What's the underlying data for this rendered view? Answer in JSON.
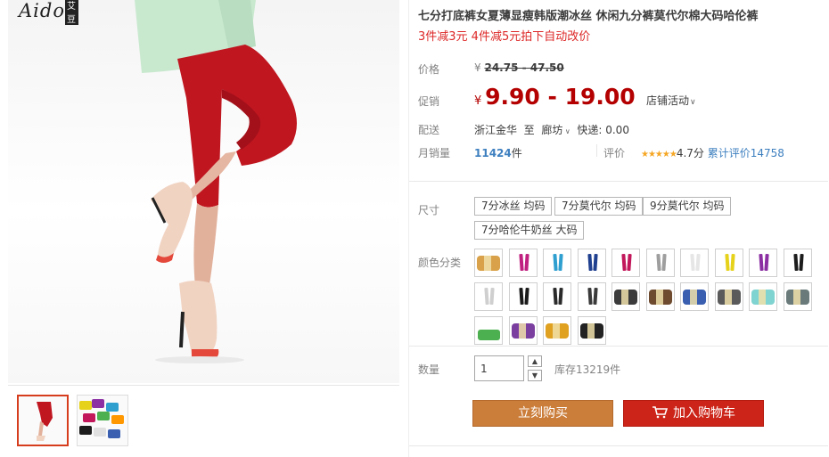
{
  "brand": {
    "logo_text": "Aidou",
    "seal_text": "艾豆"
  },
  "title": "七分打底裤女夏薄显瘦韩版潮冰丝 休闲九分裤莫代尔棉大码哈伦裤",
  "promo_text": "3件减3元 4件减5元拍下自动改价",
  "price": {
    "label": "价格",
    "currency": "¥",
    "original": "24.75 - 47.50"
  },
  "promo_price": {
    "label": "促销",
    "currency": "¥",
    "value": "9.90 - 19.00",
    "shop_activity": "店铺活动"
  },
  "shipping": {
    "label": "配送",
    "from": "浙江金华",
    "to_word": "至",
    "to": "廊坊",
    "express": "快递: 0.00"
  },
  "sales": {
    "label": "月销量",
    "count": "11424",
    "unit": "件"
  },
  "rating": {
    "label": "评价",
    "stars": "★★★★★",
    "score": "4.7分",
    "review_link": "累计评价14758"
  },
  "size": {
    "label": "尺寸",
    "options": [
      "7分冰丝 均码",
      "7分莫代尔 均码",
      "9分莫代尔 均码",
      "7分哈伦牛奶丝 大码"
    ]
  },
  "color": {
    "label": "颜色分类",
    "swatches": [
      {
        "kind": "roll",
        "color": "#d9a24a"
      },
      {
        "kind": "legs",
        "color": "#c0207f"
      },
      {
        "kind": "legs",
        "color": "#2f9fd0"
      },
      {
        "kind": "legs",
        "color": "#1f3f8f"
      },
      {
        "kind": "legs",
        "color": "#c2185b"
      },
      {
        "kind": "legs",
        "color": "#9e9e9e"
      },
      {
        "kind": "legs",
        "color": "#e6e6e6"
      },
      {
        "kind": "legs",
        "color": "#e6d21a"
      },
      {
        "kind": "legs",
        "color": "#8b2fa3"
      },
      {
        "kind": "legs",
        "color": "#1c1c1c"
      },
      {
        "kind": "legs",
        "color": "#cfcfcf"
      },
      {
        "kind": "legs",
        "color": "#1a1a1a"
      },
      {
        "kind": "legs",
        "color": "#2a2a2a"
      },
      {
        "kind": "legs",
        "color": "#3a3a3a"
      },
      {
        "kind": "roll",
        "color": "#3b3b3b"
      },
      {
        "kind": "roll",
        "color": "#6e4a2e"
      },
      {
        "kind": "roll",
        "color": "#3a5fb0"
      },
      {
        "kind": "roll",
        "color": "#5a5a5a"
      },
      {
        "kind": "roll",
        "color": "#7fd3d0"
      },
      {
        "kind": "roll",
        "color": "#6a7a7a"
      },
      {
        "kind": "pile",
        "color": "#4caf50"
      },
      {
        "kind": "roll",
        "color": "#7b3fa0"
      },
      {
        "kind": "roll",
        "color": "#e0a020"
      },
      {
        "kind": "roll",
        "color": "#222222"
      }
    ]
  },
  "quantity": {
    "label": "数量",
    "value": "1",
    "stock": "库存13219件"
  },
  "actions": {
    "buy_now": "立刻购买",
    "add_to_cart": "加入购物车"
  },
  "colors": {
    "promo_red": "#b40000",
    "buy_orange": "#cb7d3a",
    "cart_red": "#cc2418",
    "link_blue": "#3d7fbf"
  }
}
